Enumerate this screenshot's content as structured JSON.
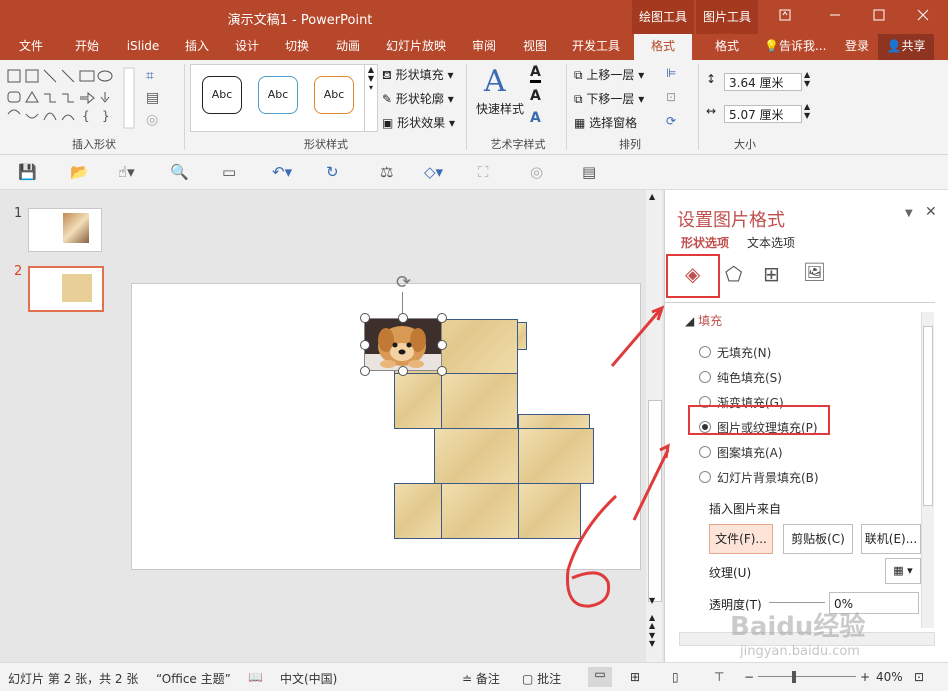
{
  "window": {
    "title": "演示文稿1 - PowerPoint",
    "context_tabs": [
      "绘图工具",
      "图片工具"
    ],
    "controls": [
      "restore-icon",
      "minimize-icon",
      "maximize-icon",
      "close-icon"
    ]
  },
  "tabs": [
    {
      "label": "文件"
    },
    {
      "label": "开始"
    },
    {
      "label": "iSlide"
    },
    {
      "label": "插入"
    },
    {
      "label": "设计"
    },
    {
      "label": "切换"
    },
    {
      "label": "动画"
    },
    {
      "label": "幻灯片放映"
    },
    {
      "label": "审阅"
    },
    {
      "label": "视图"
    },
    {
      "label": "开发工具"
    },
    {
      "label": "格式"
    },
    {
      "label": "格式"
    }
  ],
  "tell_me": "告诉我...",
  "login": "登录",
  "share": "共享",
  "ribbon": {
    "groups": {
      "insert_shapes": "插入形状",
      "shape_styles": "形状样式",
      "wordart": "艺术字样式",
      "arrange": "排列",
      "size": "大小"
    },
    "style_samples": [
      "Abc",
      "Abc",
      "Abc"
    ],
    "shape_fill": "形状填充",
    "shape_outline": "形状轮廓",
    "shape_effects": "形状效果",
    "quick_styles": "快速样式",
    "bring_forward": "上移一层",
    "send_backward": "下移一层",
    "selection_pane": "选择窗格",
    "height_value": "3.64 厘米",
    "width_value": "5.07 厘米"
  },
  "thumbnails": [
    {
      "num": "1"
    },
    {
      "num": "2"
    }
  ],
  "pane": {
    "title": "设置图片格式",
    "tab_shape": "形状选项",
    "tab_text": "文本选项",
    "section_fill": "填充",
    "options": [
      {
        "label": "无填充(N)",
        "selected": false
      },
      {
        "label": "纯色填充(S)",
        "selected": false
      },
      {
        "label": "渐变填充(G)",
        "selected": false
      },
      {
        "label": "图片或纹理填充(P)",
        "selected": true
      },
      {
        "label": "图案填充(A)",
        "selected": false
      },
      {
        "label": "幻灯片背景填充(B)",
        "selected": false
      }
    ],
    "insert_from": "插入图片来自",
    "btn_file": "文件(F)...",
    "btn_clipboard": "剪贴板(C)",
    "btn_online": "联机(E)...",
    "texture": "纹理(U)",
    "transparency": "透明度(T)",
    "transparency_value": "0%"
  },
  "status": {
    "slide_info": "幻灯片 第 2 张，共 2 张",
    "theme": "“Office 主题”",
    "language": "中文(中国)",
    "notes": "备注",
    "comments": "批注",
    "zoom": "40%"
  },
  "watermark": {
    "main": "Baidu经验",
    "sub": "jingyan.baidu.com"
  },
  "colors": {
    "accent": "#b7472a",
    "annotation": "#e03a3a"
  }
}
